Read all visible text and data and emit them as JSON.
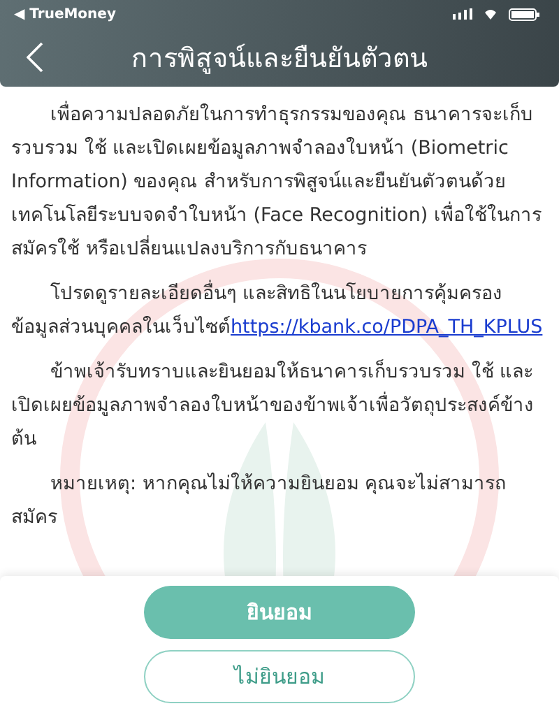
{
  "status_bar": {
    "back_app": "◀ TrueMoney"
  },
  "header": {
    "title": "การพิสูจน์และยืนยันตัวตน"
  },
  "paragraphs": [
    {
      "kind": "text",
      "text": "เพื่อความปลอดภัยในการทำธุรกรรมของคุณ ธนาคารจะเก็บรวบรวม ใช้ และเปิดเผยข้อมูลภาพจำลองใบหน้า (Biometric Information) ของคุณ สำหรับการพิสูจน์และยืนยันตัวตนด้วยเทคโนโลยีระบบจดจำใบหน้า (Face Recognition) เพื่อใช้ในการสมัครใช้ หรือเปลี่ยนแปลงบริการกับธนาคาร"
    },
    {
      "kind": "link",
      "text": "โปรดดูรายละเอียดอื่นๆ และสิทธิในนโยบายการคุ้มครองข้อมูลส่วนบุคคลในเว็บไซต์",
      "link": "https://kbank.co/PDPA_TH_KPLUS"
    },
    {
      "kind": "text",
      "text": "ข้าพเจ้ารับทราบและยินยอมให้ธนาคารเก็บรวบรวม ใช้ และเปิดเผยข้อมูลภาพจำลองใบหน้าของข้าพเจ้าเพื่อวัตถุประสงค์ข้างต้น"
    },
    {
      "kind": "text",
      "text": "หมายเหตุ: หากคุณไม่ให้ความยินยอม คุณจะไม่สามารถสมัคร"
    }
  ],
  "buttons": [
    {
      "label": "ยินยอม",
      "kind": "primary"
    },
    {
      "label": "ไม่ยินยอม",
      "kind": "outline"
    }
  ]
}
